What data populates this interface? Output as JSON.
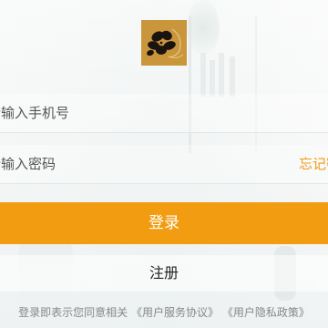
{
  "logo": {
    "icon": "flower-logo-icon",
    "background_color": "#c9963c"
  },
  "login_form": {
    "phone_input": {
      "placeholder": "请输入手机号",
      "value": ""
    },
    "password_input": {
      "placeholder": "请输入密码",
      "value": ""
    },
    "forgot_password_label": "忘记密码"
  },
  "actions": {
    "login_label": "登录",
    "register_label": "注册"
  },
  "agreement": {
    "prefix": "登录即表示您同意相关",
    "user_service_agreement": "《用户服务协议》",
    "privacy_policy": "《用户隐私政策》"
  },
  "colors": {
    "accent": "#f29c11",
    "link": "#f29b14"
  }
}
